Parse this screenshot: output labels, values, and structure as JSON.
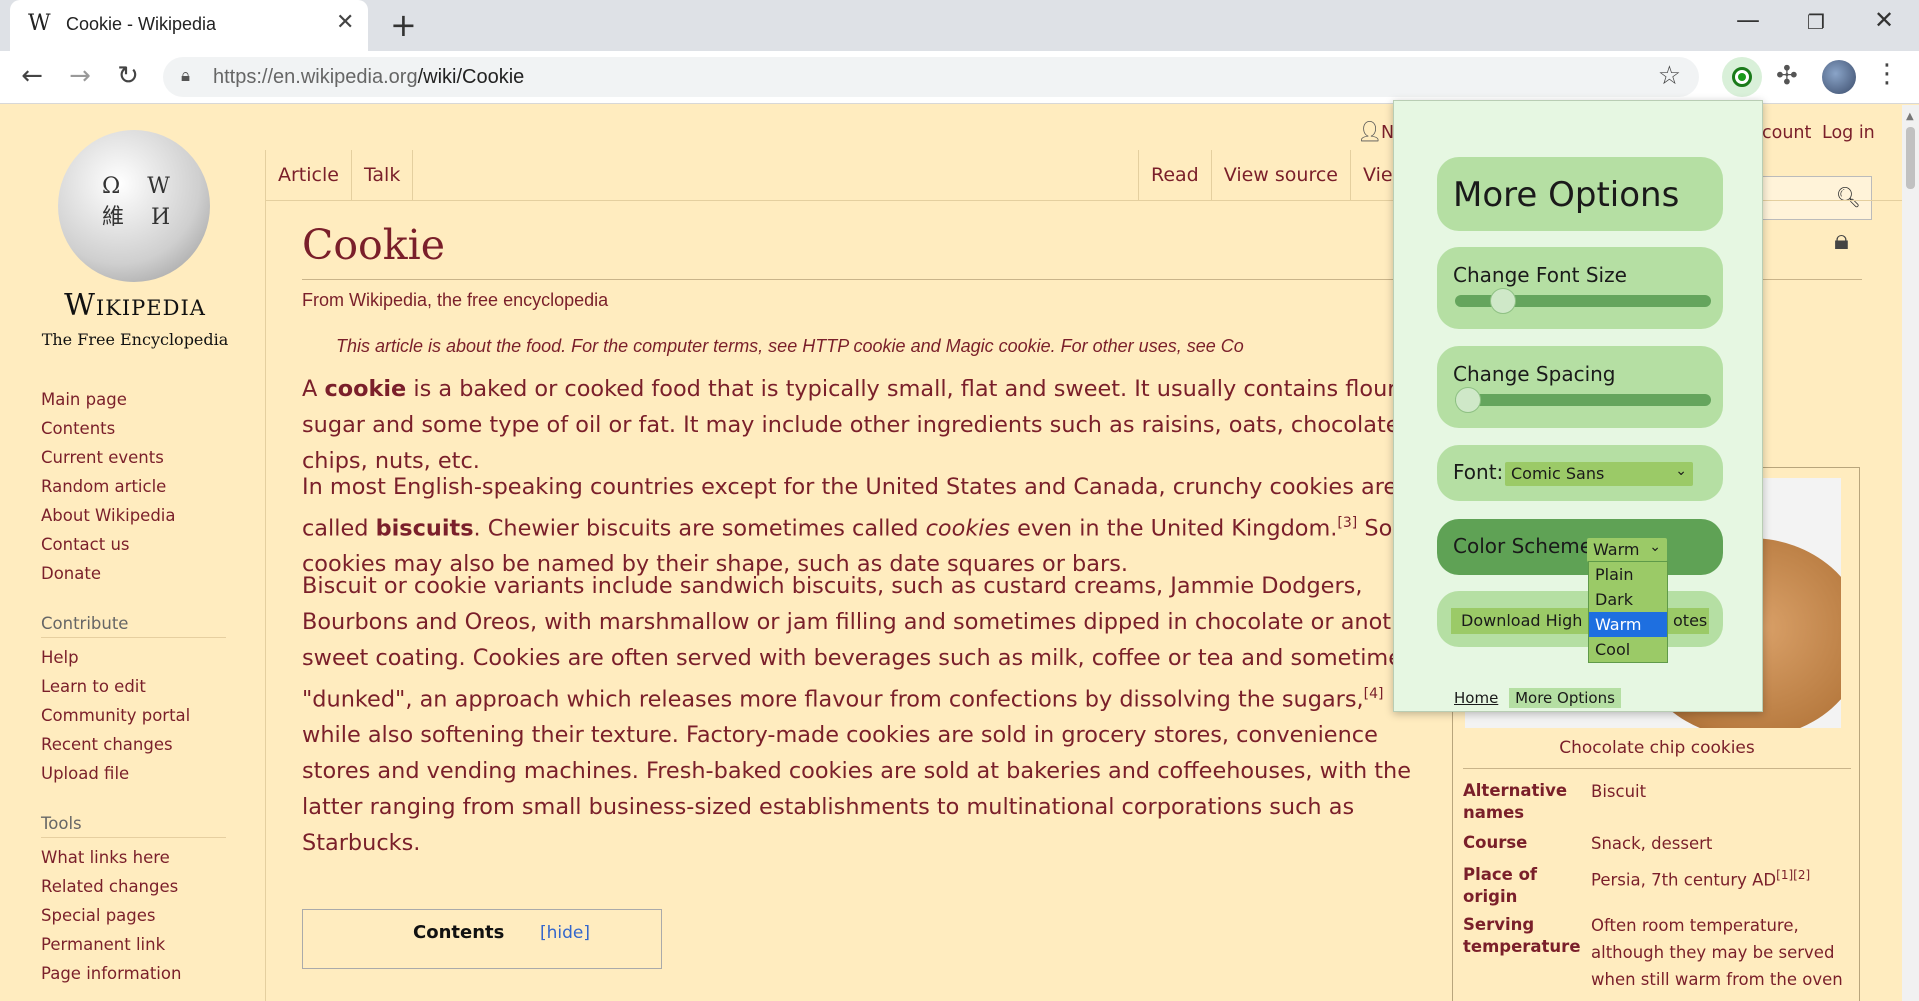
{
  "browser": {
    "tab_title": "Cookie - Wikipedia",
    "tab_favicon": "W",
    "url_host": "https://en.wikipedia.org",
    "url_path": "/wiki/Cookie",
    "icons": [
      "back-icon",
      "forward-icon",
      "reload-icon",
      "lock-icon",
      "star-icon",
      "extension-icon",
      "puzzle-icon",
      "menu-icon"
    ]
  },
  "wiki": {
    "wordmark": "Wikipedia",
    "tagline": "The Free Encyclopedia",
    "globe_letters": "Ω W 維 И",
    "top_links": {
      "not_logged": "N",
      "create_account": "count",
      "login": "Log in"
    },
    "tabs_left": [
      "Article",
      "Talk"
    ],
    "tabs_right": [
      "Read",
      "View source",
      "View"
    ],
    "sidebar": {
      "nav": [
        "Main page",
        "Contents",
        "Current events",
        "Random article",
        "About Wikipedia",
        "Contact us",
        "Donate"
      ],
      "contribute_heading": "Contribute",
      "contribute": [
        "Help",
        "Learn to edit",
        "Community portal",
        "Recent changes",
        "Upload file"
      ],
      "tools_heading": "Tools",
      "tools": [
        "What links here",
        "Related changes",
        "Special pages",
        "Permanent link",
        "Page information"
      ]
    },
    "title": "Cookie",
    "from": "From Wikipedia, the free encyclopedia",
    "hatnote": "This article is about the food. For the computer terms, see HTTP cookie and Magic cookie. For other uses, see Co",
    "para1": {
      "a": "A ",
      "b": "cookie",
      "c": " is a baked or cooked food that is typically small, flat and sweet. It usually contains flour, sugar and some type of oil or fat. It may include other ingredients such as raisins, oats, chocolate chips, nuts, etc."
    },
    "para2": {
      "a": "In most English-speaking countries except for the United States and Canada, crunchy cookies are called ",
      "b": "biscuits",
      "c": ". Chewier biscuits are sometimes called ",
      "d": "cookies",
      "e": " even in the United Kingdom.",
      "sup": "[3]",
      "f": " Some cookies may also be named by their shape, such as date squares or bars."
    },
    "para3": {
      "a": "Biscuit or cookie variants include sandwich biscuits, such as custard creams, Jammie Dodgers, Bourbons and Oreos, with marshmallow or jam filling and sometimes dipped in chocolate or another sweet coating. Cookies are often served with beverages such as milk, coffee or tea and sometimes \"dunked\", an approach which releases more flavour from confections by dissolving the sugars,",
      "sup": "[4]",
      "b": " while also softening their texture. Factory-made cookies are sold in grocery stores, convenience stores and vending machines. Fresh-baked cookies are sold at bakeries and coffeehouses, with the latter ranging from small business-sized establishments to multinational corporations such as Starbucks."
    },
    "toc": {
      "title": "Contents",
      "hide": "[hide]"
    },
    "infobox": {
      "caption": "Chocolate chip cookies",
      "rows": [
        {
          "key": "Alternative names",
          "value": "Biscuit"
        },
        {
          "key": "Course",
          "value": "Snack, dessert"
        },
        {
          "key": "Place of origin",
          "value": "Persia, 7th century AD",
          "sup": "[1][2]"
        },
        {
          "key": "Serving temperature",
          "value": "Often room temperature, although they may be served when still warm from the oven"
        }
      ]
    }
  },
  "popup": {
    "title": "More Options",
    "font_size_label": "Change Font Size",
    "font_size_level": 0.15,
    "spacing_label": "Change Spacing",
    "spacing_level": 0.0,
    "font_label": "Font:",
    "font_value": "Comic Sans",
    "scheme_label": "Color Scheme:",
    "scheme_value": "Warm",
    "scheme_options": [
      "Plain",
      "Dark",
      "Warm",
      "Cool"
    ],
    "download_label_left": "Download High",
    "download_label_right": "otes",
    "link_home": "Home",
    "link_more": "More Options",
    "colors": {
      "popup_bg": "#e6f7e2",
      "card": "#b5dfa3",
      "card_active": "#5fa255",
      "select": "#9bca67",
      "highlight": "#1e6fe0"
    }
  }
}
